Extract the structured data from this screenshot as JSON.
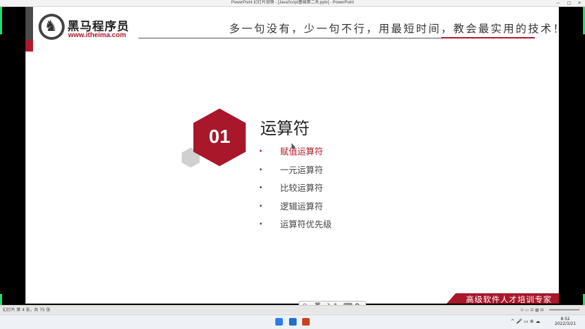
{
  "window": {
    "title": "PowerPoint 幻灯片放映 - [JavaScript基础第二天.pptx] - PowerPoint",
    "min": "—",
    "max": "□",
    "close": "✕"
  },
  "slide": {
    "logo": {
      "brand": "黑马程序员",
      "url": "www.itheima.com",
      "icon": "horse-logo-icon"
    },
    "slogan": "多一句没有，少一句不行，用最短时间，教会最实用的技术！",
    "badge_number": "01",
    "section_title": "运算符",
    "bullet_glyph": "•",
    "items": [
      {
        "label": "赋值运算符",
        "active": true
      },
      {
        "label": "一元运算符",
        "active": false
      },
      {
        "label": "比较运算符",
        "active": false
      },
      {
        "label": "逻辑运算符",
        "active": false
      },
      {
        "label": "运算符优先级",
        "active": false
      }
    ],
    "footer_ribbon": "高级软件人才培训专家",
    "colors": {
      "accent": "#a8172a",
      "text": "#444444"
    }
  },
  "ime": {
    "items": [
      "◎",
      "英",
      "☽",
      "°,",
      "⌨",
      "⚙"
    ]
  },
  "statusbar": {
    "slide_info": "幻灯片 第 4 张，共 75 张"
  },
  "taskbar": {
    "apps": [
      "windows-start-icon",
      "file-explorer-icon",
      "powerpoint-icon"
    ],
    "tray": "^  🎤  ▭  ⊕  ☁",
    "time": "8:52",
    "date": "2022/3/21"
  }
}
